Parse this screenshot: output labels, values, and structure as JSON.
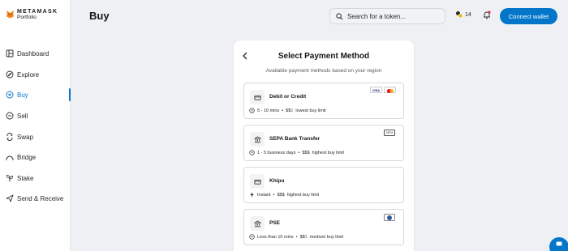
{
  "brand": {
    "title": "METAMASK",
    "subtitle": "Portfolio"
  },
  "sidebar": {
    "items": [
      {
        "label": "Dashboard",
        "icon": "dashboard-icon",
        "active": false
      },
      {
        "label": "Explore",
        "icon": "compass-icon",
        "active": false
      },
      {
        "label": "Buy",
        "icon": "plus-circle-icon",
        "active": true
      },
      {
        "label": "Sell",
        "icon": "minus-circle-icon",
        "active": false
      },
      {
        "label": "Swap",
        "icon": "swap-icon",
        "active": false
      },
      {
        "label": "Bridge",
        "icon": "bridge-icon",
        "active": false
      },
      {
        "label": "Stake",
        "icon": "stake-icon",
        "active": false
      },
      {
        "label": "Send & Receive",
        "icon": "send-icon",
        "active": false
      }
    ]
  },
  "header": {
    "title": "Buy",
    "search_placeholder": "Search for a token...",
    "network_count": "14",
    "connect_label": "Connect wallet"
  },
  "panel": {
    "title": "Select Payment Method",
    "subtitle": "Available payment methods based on your region",
    "methods": [
      {
        "name": "Debit or Credit",
        "time": "5 - 10 mins",
        "cost": "$$",
        "cost_dim": "$",
        "limit": "lowest buy limit",
        "badges": [
          "VISA",
          "mastercard"
        ]
      },
      {
        "name": "SEPA Bank Transfer",
        "time": "1 - 5 business days",
        "cost": "$$$",
        "cost_dim": "",
        "limit": "highest buy limit",
        "badges": [
          "SEPA"
        ]
      },
      {
        "name": "Khipu",
        "time": "Instant",
        "cost": "$$$",
        "cost_dim": "",
        "limit": "highest buy limit",
        "badges": []
      },
      {
        "name": "PSE",
        "time": "Less than 10 mins",
        "cost": "$$",
        "cost_dim": "$",
        "limit": "medium buy limit",
        "badges": [
          "PSE"
        ]
      }
    ]
  },
  "colors": {
    "accent": "#0376c9",
    "background": "#eef0f3",
    "text": "#141618"
  }
}
